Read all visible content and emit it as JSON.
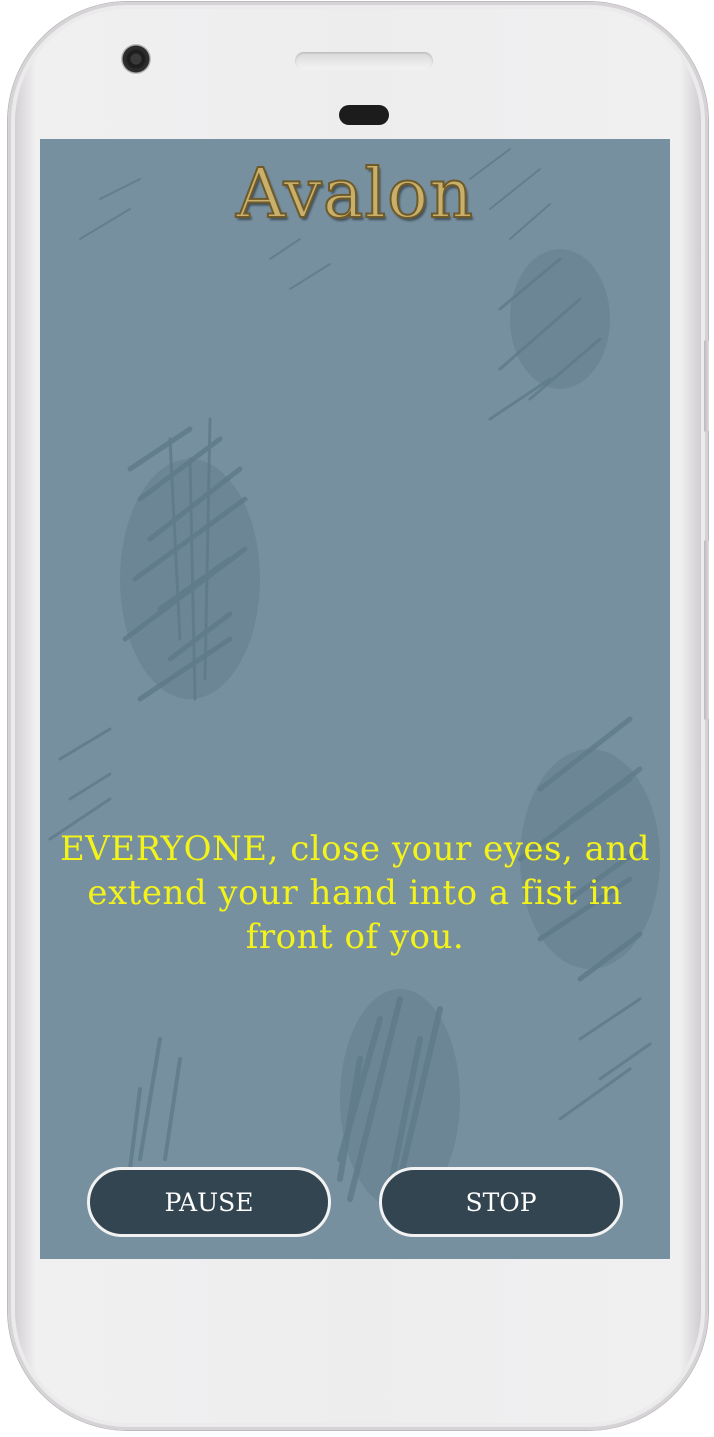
{
  "app": {
    "title": "Avalon"
  },
  "narration": {
    "text": "EVERYONE, close your eyes, and extend your hand into a fist in front of you."
  },
  "controls": {
    "pause_label": "PAUSE",
    "stop_label": "STOP"
  },
  "colors": {
    "background": "#7790a0",
    "title": "#c9b06a",
    "narration_text": "#f3f31a",
    "button_fill": "#324550",
    "button_border": "#f2f2f2"
  }
}
